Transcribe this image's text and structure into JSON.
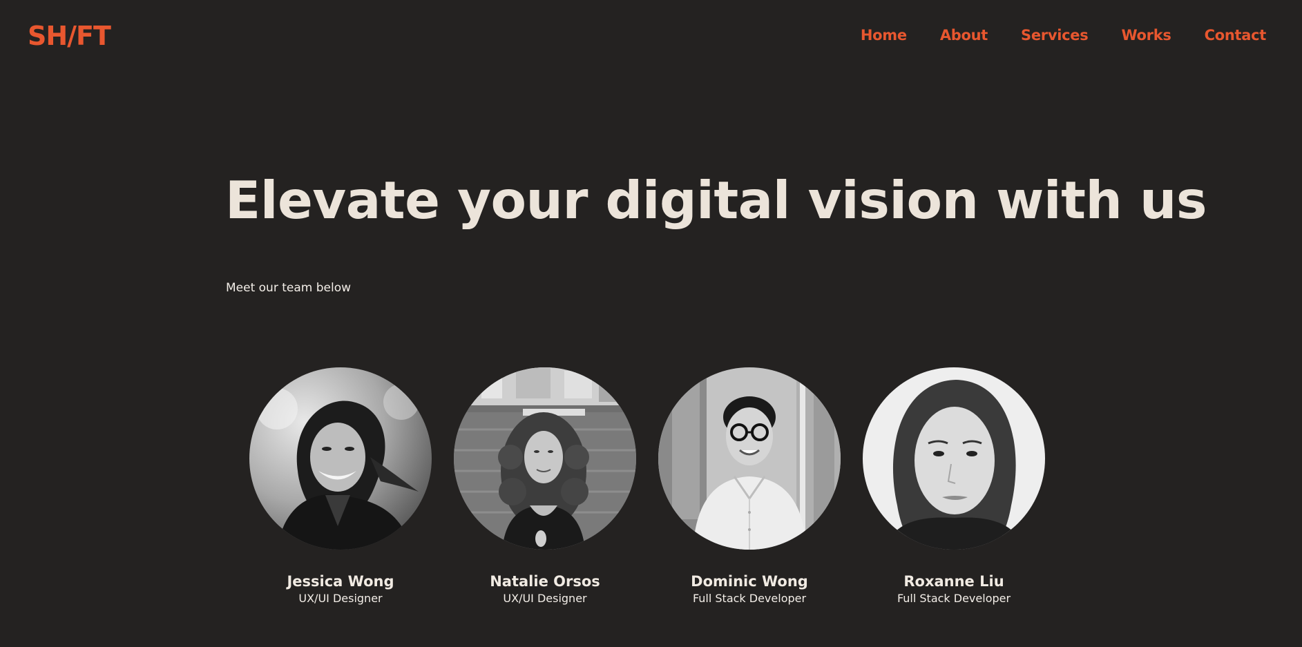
{
  "header": {
    "logo": "SH/FT",
    "nav": [
      {
        "label": "Home"
      },
      {
        "label": "About"
      },
      {
        "label": "Services"
      },
      {
        "label": "Works"
      },
      {
        "label": "Contact"
      }
    ]
  },
  "hero": {
    "title": "Elevate your digital vision with us",
    "subtitle": "Meet our team below"
  },
  "team": [
    {
      "name": "Jessica Wong",
      "role": "UX/UI Designer"
    },
    {
      "name": "Natalie Orsos",
      "role": "UX/UI Designer"
    },
    {
      "name": "Dominic Wong",
      "role": "Full Stack Developer"
    },
    {
      "name": "Roxanne Liu",
      "role": "Full Stack Developer"
    }
  ],
  "colors": {
    "background": "#242221",
    "accent": "#e8572f",
    "heading": "#ece4da",
    "text": "#f3eee8"
  }
}
